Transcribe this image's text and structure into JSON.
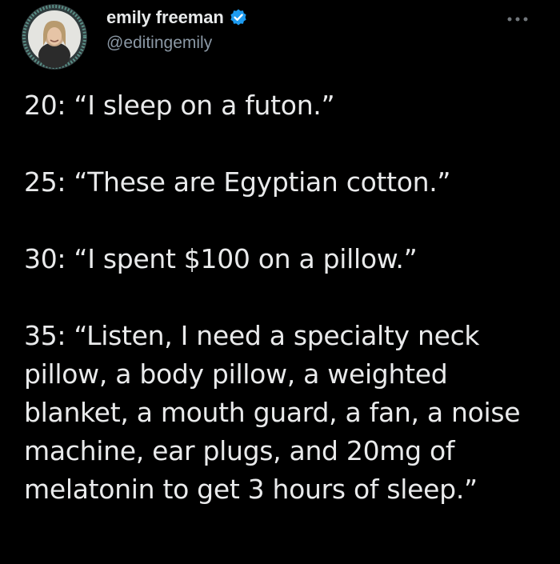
{
  "author": {
    "display_name": "emily freeman",
    "handle": "@editingemily",
    "verified": true,
    "avatar_icon": "avatar-photo",
    "verified_icon": "verified-badge-icon",
    "verified_color": "#1d9bf0"
  },
  "tweet": {
    "paragraphs": [
      "20: “I sleep on a futon.”",
      "25: “These are Egyptian cotton.”",
      "30: “I spent $100 on a pillow.”",
      "35: “Listen, I need a specialty neck pillow, a body pillow, a weighted blanket, a mouth guard, a fan, a noise machine, ear plugs, and 20mg of melatonin to get 3 hours of sleep.”"
    ]
  },
  "menu": {
    "icon": "more-options-icon"
  },
  "colors": {
    "background": "#000000",
    "text": "#e7e9ea",
    "secondary_text": "#8b98a5",
    "accent": "#1d9bf0"
  }
}
